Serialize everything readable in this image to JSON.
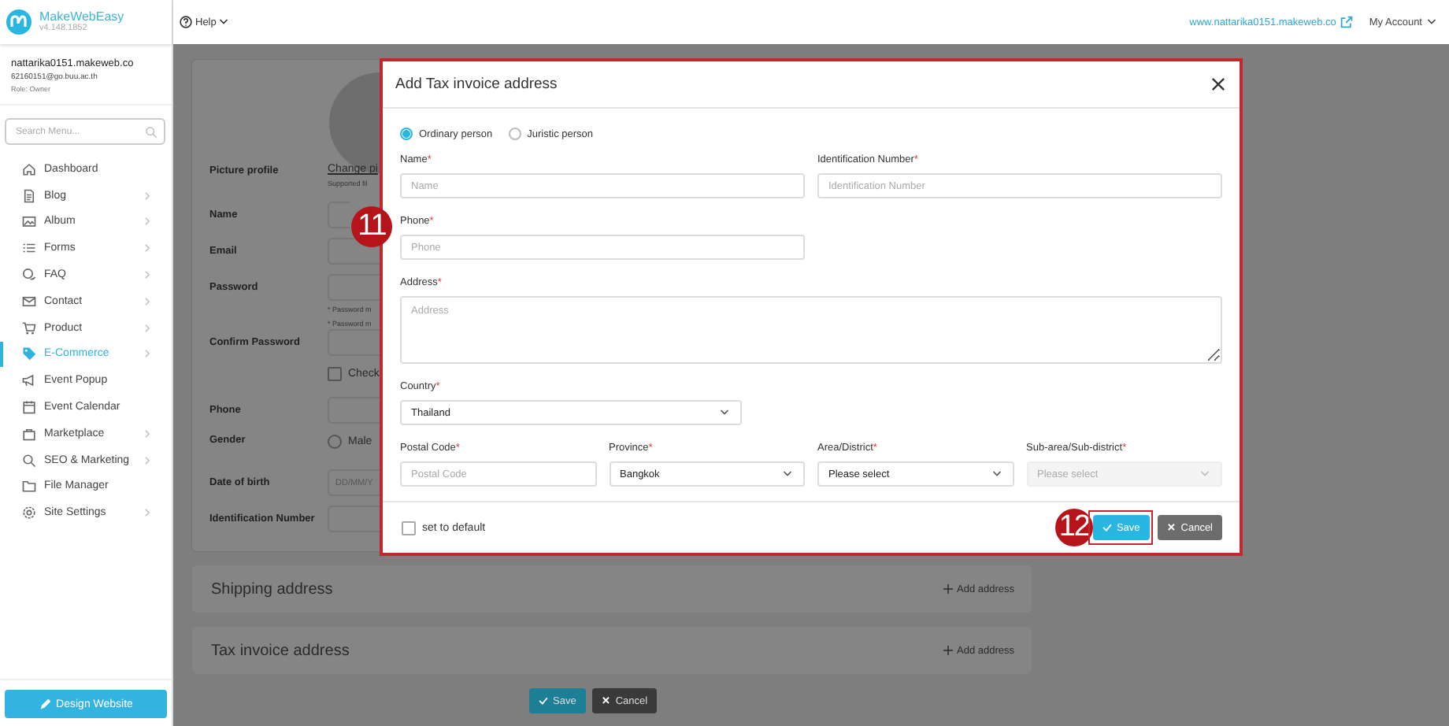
{
  "app": {
    "name": "MakeWebEasy",
    "version": "v4.148.1852"
  },
  "header": {
    "help": "Help",
    "site_link": "www.nattarika0151.makeweb.co",
    "account": "My Account"
  },
  "user": {
    "site": "nattarika0151.makeweb.co",
    "email": "62160151@go.buu.ac.th",
    "role": "Role: Owner"
  },
  "search": {
    "placeholder": "Search Menu..."
  },
  "menu": [
    {
      "label": "Dashboard",
      "has_children": false,
      "selected": false
    },
    {
      "label": "Blog",
      "has_children": true,
      "selected": false
    },
    {
      "label": "Album",
      "has_children": true,
      "selected": false
    },
    {
      "label": "Forms",
      "has_children": true,
      "selected": false
    },
    {
      "label": "FAQ",
      "has_children": true,
      "selected": false
    },
    {
      "label": "Contact",
      "has_children": true,
      "selected": false
    },
    {
      "label": "Product",
      "has_children": true,
      "selected": false
    },
    {
      "label": "E-Commerce",
      "has_children": true,
      "selected": true
    },
    {
      "label": "Event Popup",
      "has_children": false,
      "selected": false
    },
    {
      "label": "Event Calendar",
      "has_children": false,
      "selected": false
    },
    {
      "label": "Marketplace",
      "has_children": true,
      "selected": false
    },
    {
      "label": "SEO & Marketing",
      "has_children": true,
      "selected": false
    },
    {
      "label": "File Manager",
      "has_children": false,
      "selected": false
    },
    {
      "label": "Site Settings",
      "has_children": true,
      "selected": false
    }
  ],
  "design_button": "Design Website",
  "profile_form": [
    {
      "label": "Picture profile",
      "kind": "picture",
      "link": "Change pi",
      "note": "Supported fil"
    },
    {
      "label": "Name",
      "kind": "input"
    },
    {
      "label": "Email",
      "kind": "input"
    },
    {
      "label": "Password",
      "kind": "input",
      "notes": [
        "* Password m",
        "* Password m"
      ]
    },
    {
      "label": "Confirm Password",
      "kind": "input"
    },
    {
      "kind": "checkbox",
      "text": "Check",
      "checked": false
    },
    {
      "label": "Phone",
      "kind": "input"
    },
    {
      "label": "Gender",
      "kind": "radio",
      "text": "Male",
      "selected": false
    },
    {
      "label": "Date of birth",
      "kind": "input",
      "placeholder": "DD/MM/Y"
    },
    {
      "label": "Identification Number",
      "kind": "input"
    }
  ],
  "sections": [
    {
      "title": "Shipping address",
      "action": "Add address"
    },
    {
      "title": "Tax invoice address",
      "action": "Add address"
    }
  ],
  "page_buttons": [
    {
      "label": "Save",
      "kind": "save"
    },
    {
      "label": "Cancel",
      "kind": "cancel"
    }
  ],
  "modal": {
    "title": "Add Tax invoice address",
    "person_types": [
      {
        "label": "Ordinary person",
        "selected": true
      },
      {
        "label": "Juristic person",
        "selected": false
      }
    ],
    "fields": [
      {
        "label": "Name",
        "mark": "*",
        "kind": "input",
        "placeholder": "Name"
      },
      {
        "label": "Identification Number",
        "mark": "*",
        "kind": "input",
        "placeholder": "Identification Number"
      },
      {
        "label": "Phone",
        "mark": "*",
        "kind": "input",
        "placeholder": "Phone"
      },
      {
        "label": "Address",
        "mark": "*",
        "kind": "textarea",
        "placeholder": "Address"
      },
      {
        "label": "Country",
        "mark": "*",
        "kind": "select",
        "value": "Thailand",
        "disabled": false
      },
      {
        "label": "Postal Code",
        "mark": "*",
        "kind": "input",
        "placeholder": "Postal Code"
      },
      {
        "label": "Province",
        "mark": "*",
        "kind": "select",
        "value": "Bangkok",
        "disabled": false
      },
      {
        "label": "Area/District",
        "mark": "*",
        "kind": "select",
        "value": "Please select",
        "disabled": false
      },
      {
        "label": "Sub-area/Sub-district",
        "mark": "*",
        "kind": "select",
        "value": "Please select",
        "disabled": true
      }
    ],
    "default": {
      "label": "set to default",
      "checked": false
    },
    "buttons": [
      {
        "label": "Save",
        "kind": "save"
      },
      {
        "label": "Cancel",
        "kind": "cancel"
      }
    ]
  },
  "annotations": [
    {
      "number": "11"
    },
    {
      "number": "12"
    }
  ]
}
